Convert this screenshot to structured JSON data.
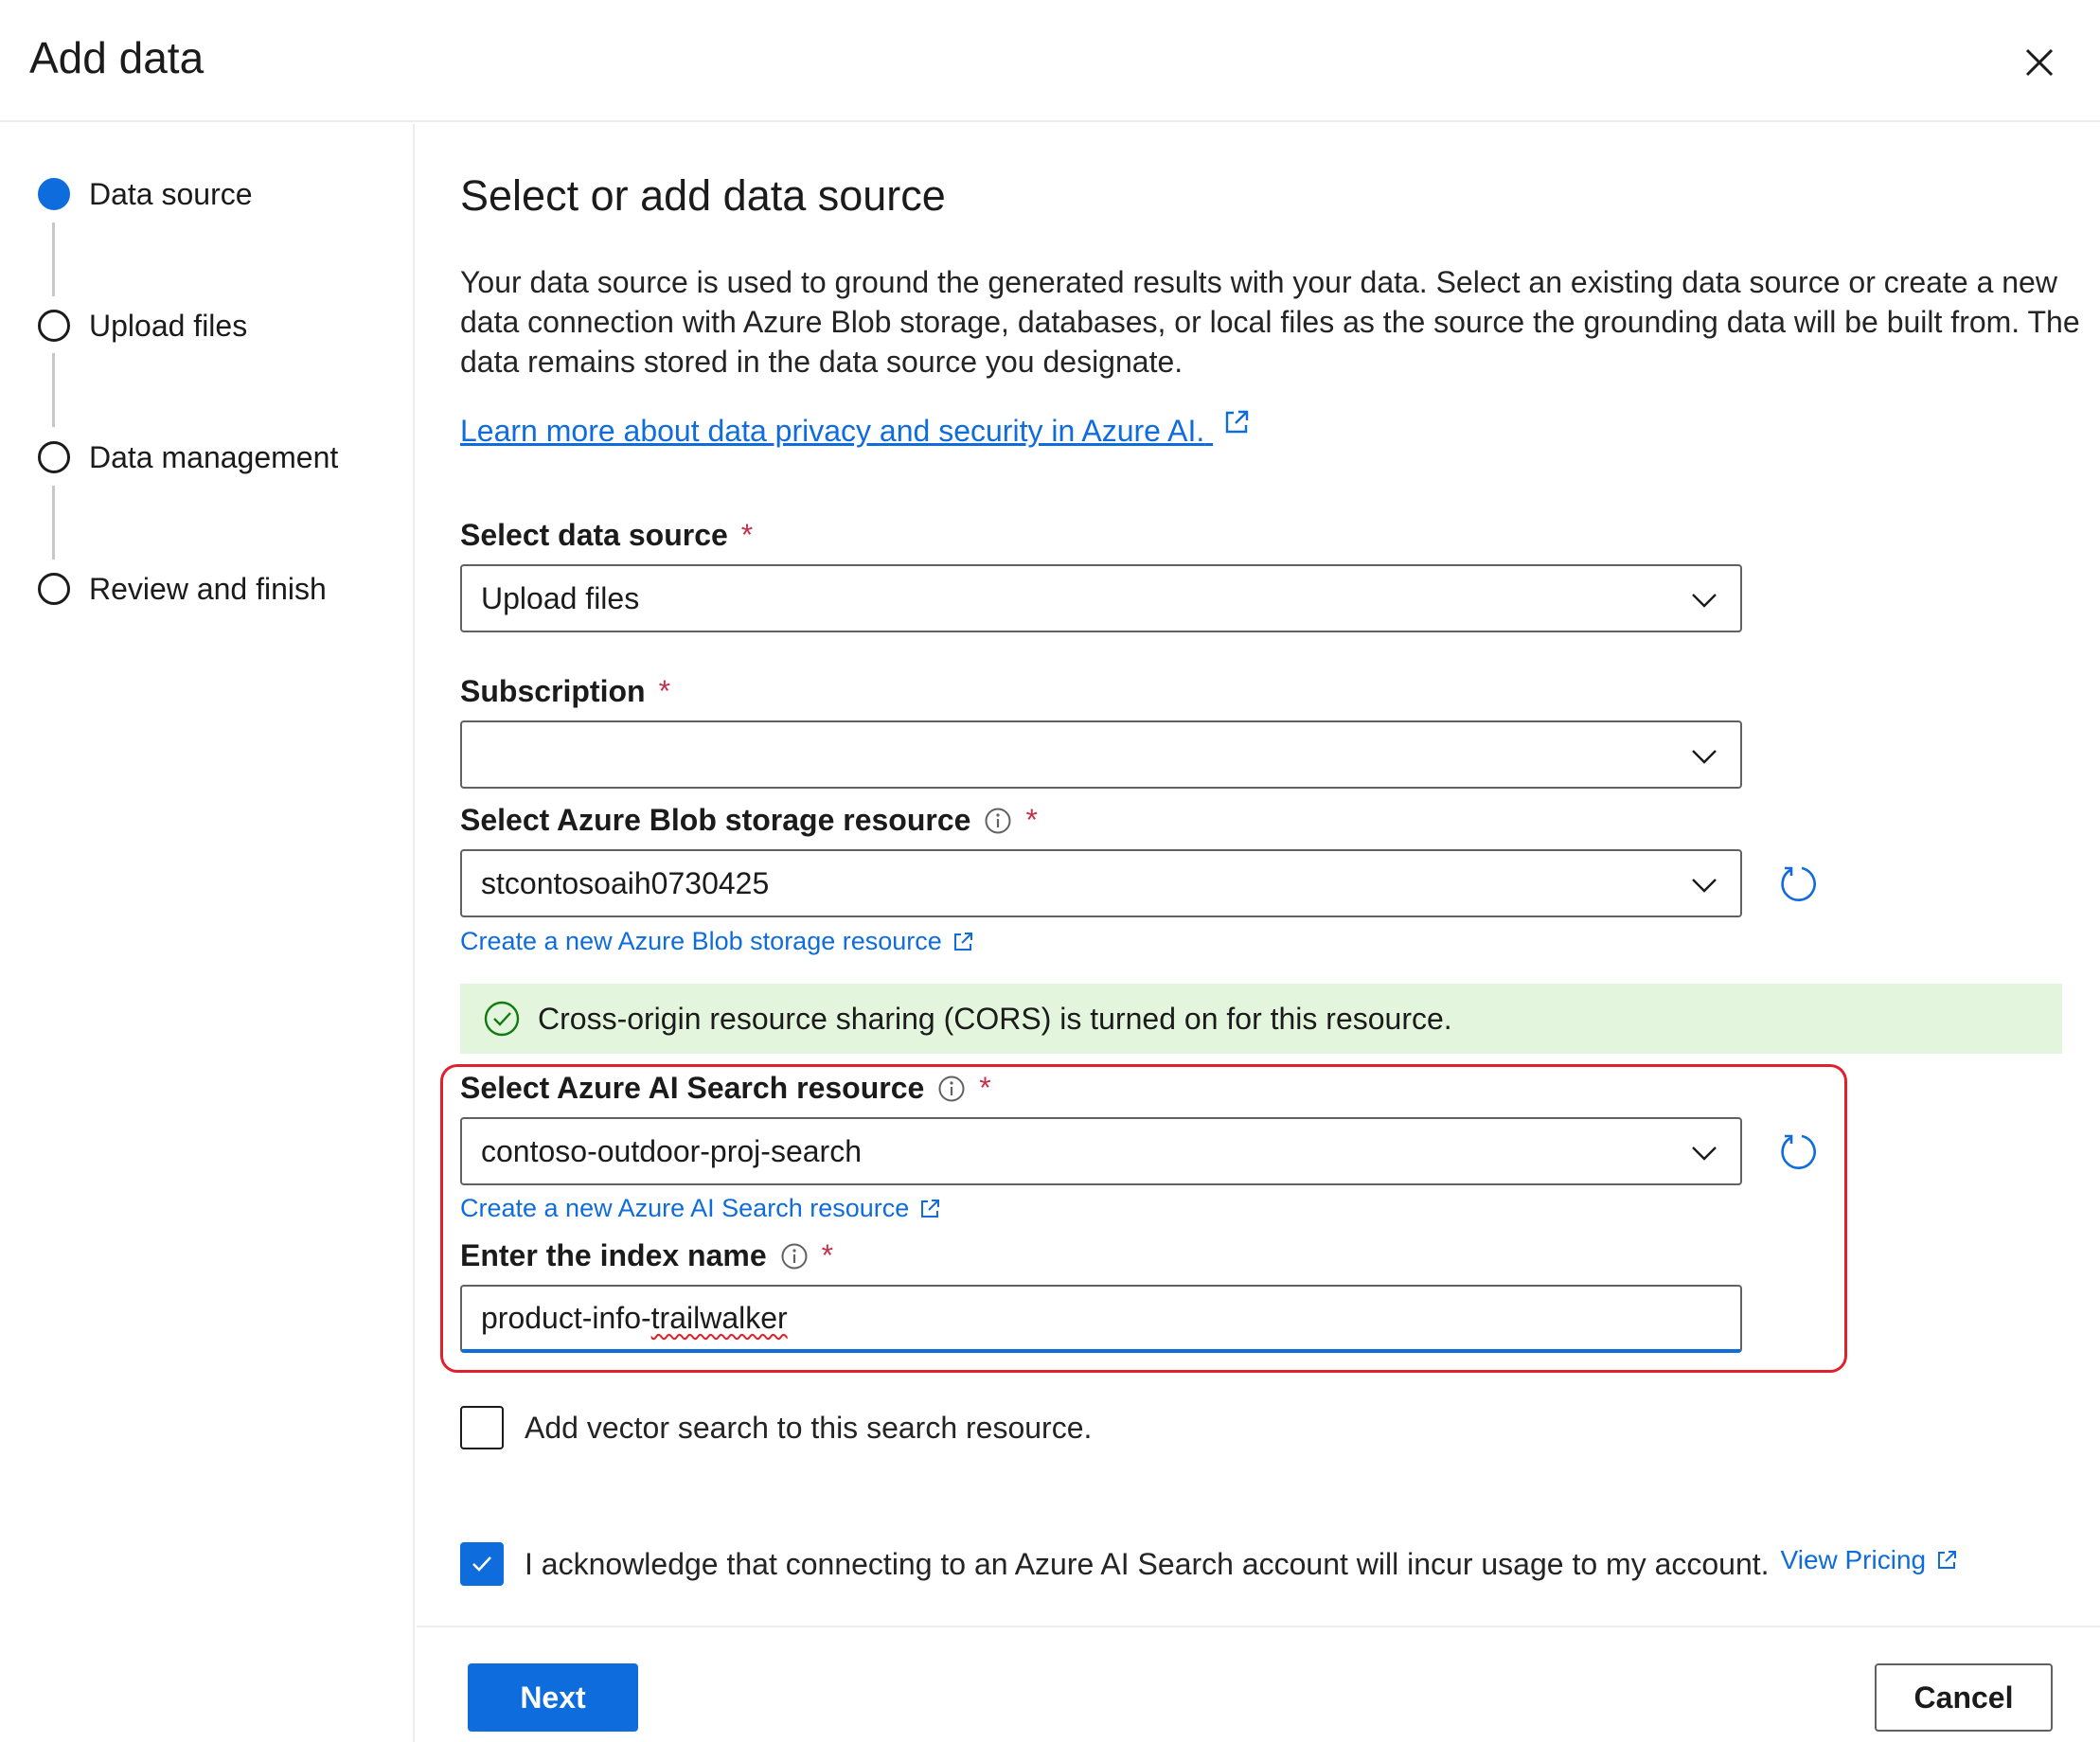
{
  "dialog": {
    "title": "Add data",
    "close_icon": "close-icon"
  },
  "steps": [
    {
      "label": "Data source",
      "state": "active"
    },
    {
      "label": "Upload files",
      "state": "pending"
    },
    {
      "label": "Data management",
      "state": "pending"
    },
    {
      "label": "Review and finish",
      "state": "pending"
    }
  ],
  "main": {
    "title": "Select or add data source",
    "description": "Your data source is used to ground the generated results with your data. Select an existing data source or create a new data connection with Azure Blob storage, databases, or local files as the source the grounding data will be built from. The data remains stored in the data source you designate.",
    "learn_more_link": "Learn more about data privacy and security in Azure AI."
  },
  "fields": {
    "data_source": {
      "label": "Select data source",
      "required_mark": "*",
      "value": "Upload files"
    },
    "subscription": {
      "label": "Subscription",
      "required_mark": "*",
      "value": ""
    },
    "blob_storage": {
      "label": "Select Azure Blob storage resource",
      "required_mark": "*",
      "value": "stcontosoaih0730425",
      "create_link": "Create a new Azure Blob storage resource"
    },
    "cors_message": "Cross-origin resource sharing (CORS) is turned on for this resource.",
    "search_resource": {
      "label": "Select Azure AI Search resource",
      "required_mark": "*",
      "value": "contoso-outdoor-proj-search",
      "create_link": "Create a new Azure AI Search resource"
    },
    "index_name": {
      "label": "Enter the index name",
      "required_mark": "*",
      "value_prefix": "product-info-",
      "value_misspelled": "trailwalker"
    }
  },
  "checkboxes": {
    "vector_search": {
      "label": "Add vector search to this search resource.",
      "checked": false
    },
    "acknowledge": {
      "label": "I acknowledge that connecting to an Azure AI Search account will incur usage to my account.",
      "checked": true,
      "pricing_link": "View Pricing"
    }
  },
  "footer": {
    "next_label": "Next",
    "cancel_label": "Cancel"
  },
  "colors": {
    "accent": "#0f6cdc",
    "required": "#c4314b",
    "success_bg": "#e3f5dd",
    "highlight_border": "#e0202a"
  }
}
